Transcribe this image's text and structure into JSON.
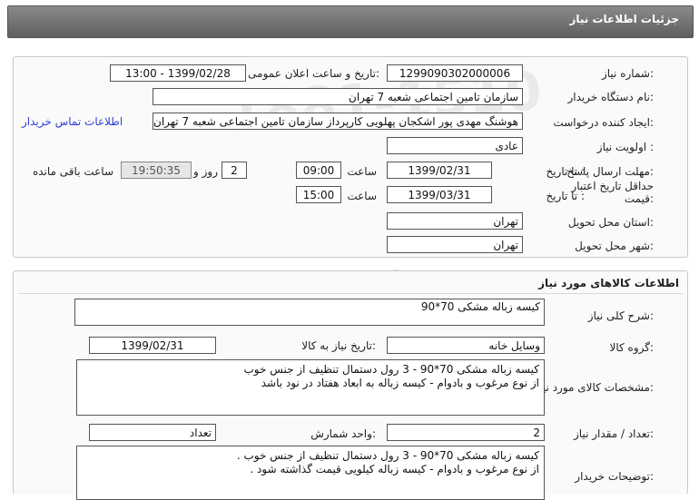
{
  "header": {
    "title": "جزئیات اطلاعات نیاز"
  },
  "watermark": {
    "text": "ParsNamadData",
    "number": "1881-1510",
    "subtext": "پایگاه اطلاعات پارس نماد داده ها"
  },
  "need_info": {
    "need_number_label": "شماره نیاز:",
    "need_number": "1299090302000006",
    "announce_label": "تاریخ و ساعت اعلان عمومی:",
    "announce_value": "1399/02/28 - 13:00",
    "buyer_org_label": "نام دستگاه خریدار:",
    "buyer_org": "سازمان تامین اجتماعی شعبه 7 تهران",
    "creator_label": "ایجاد کننده درخواست:",
    "creator": "هوشنگ مهدی پور اشکجان پهلویی کارپرداز سازمان تامین اجتماعی شعبه 7 تهران",
    "contact_link": "اطلاعات تماس خریدار",
    "priority_label": "اولویت نیاز :",
    "priority": "عادی",
    "send_deadline_label": "مهلت ارسال پاسخ:",
    "until_date_label": "تا تاریخ :",
    "send_date": "1399/02/31",
    "time_label": "ساعت",
    "send_time": "09:00",
    "days_value": "2",
    "days_label": "روز و",
    "remaining_time": "19:50:35",
    "remaining_label": "ساعت باقی مانده",
    "validity_label": "حداقل تاریخ اعتبار قیمت:",
    "validity_until_label": "تا تاریخ :",
    "validity_date": "1399/03/31",
    "validity_time_label": "ساعت",
    "validity_time": "15:00",
    "province_label": "استان محل تحویل:",
    "province": "تهران",
    "city_label": "شهر محل تحویل:",
    "city": "تهران"
  },
  "goods": {
    "section_title": "اطلاعات کالاهای مورد نیاز",
    "summary_label": "شرح کلی نیاز:",
    "summary": "کیسه  زباله مشکی 70*90",
    "group_label": "گروه کالا:",
    "group": "وسایل خانه",
    "need_date_label": "تاریخ نیاز به کالا:",
    "need_date": "1399/02/31",
    "specs_label": "مشخصات کالای مورد نیاز:",
    "specs_line1": "کیسه  زباله مشکی 70*90 -  3 رول دستمال تنظیف از جنس خوب",
    "specs_line2": "از نوع مرغوب  و بادوام  -  کیسه  زباله  به ابعاد هفتاد  در نود  باشد",
    "qty_label": "تعداد / مقدار نیاز:",
    "qty": "2",
    "unit_label": "واحد شمارش:",
    "unit": "تعداد",
    "buyer_notes_label": "توضیحات خریدار:",
    "notes_line1": "کیسه  زباله مشکی 70*90 -  3 رول دستمال تنظیف از جنس خوب .",
    "notes_line2": "از نوع مرغوب  و بادوام  - کیسه زباله کیلویی  قیمت گذاشته شود ."
  }
}
